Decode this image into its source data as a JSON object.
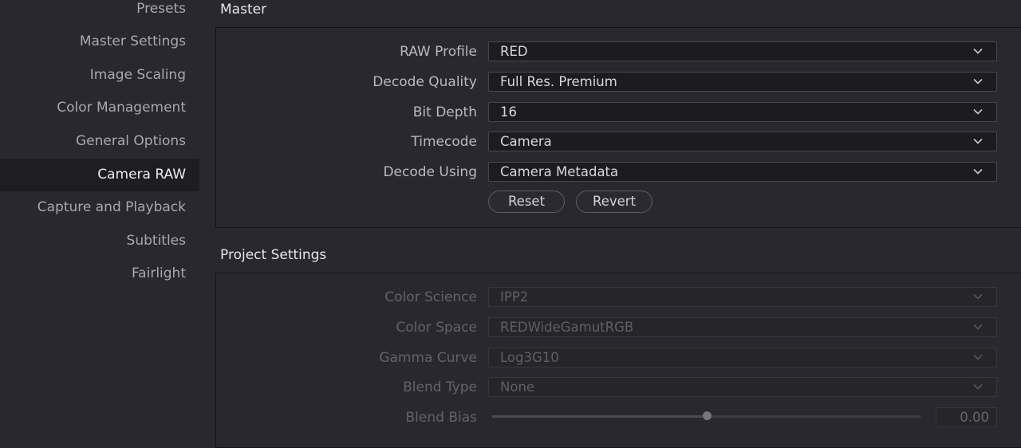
{
  "sidebar": {
    "items": [
      {
        "label": "Presets",
        "active": false
      },
      {
        "label": "Master Settings",
        "active": false
      },
      {
        "label": "Image Scaling",
        "active": false
      },
      {
        "label": "Color Management",
        "active": false
      },
      {
        "label": "General Options",
        "active": false
      },
      {
        "label": "Camera RAW",
        "active": true
      },
      {
        "label": "Capture and Playback",
        "active": false
      },
      {
        "label": "Subtitles",
        "active": false
      },
      {
        "label": "Fairlight",
        "active": false
      }
    ]
  },
  "master": {
    "title": "Master",
    "raw_profile": {
      "label": "RAW Profile",
      "value": "RED"
    },
    "decode_quality": {
      "label": "Decode Quality",
      "value": "Full Res. Premium"
    },
    "bit_depth": {
      "label": "Bit Depth",
      "value": "16"
    },
    "timecode": {
      "label": "Timecode",
      "value": "Camera"
    },
    "decode_using": {
      "label": "Decode Using",
      "value": "Camera Metadata"
    },
    "reset_label": "Reset",
    "revert_label": "Revert"
  },
  "project": {
    "title": "Project Settings",
    "color_science": {
      "label": "Color Science",
      "value": "IPP2"
    },
    "color_space": {
      "label": "Color Space",
      "value": "REDWideGamutRGB"
    },
    "gamma_curve": {
      "label": "Gamma Curve",
      "value": "Log3G10"
    },
    "blend_type": {
      "label": "Blend Type",
      "value": "None"
    },
    "blend_bias": {
      "label": "Blend Bias",
      "value": "0.00",
      "slider_fraction": 0.5
    }
  },
  "icons": {
    "dropdown": "chevron-down-icon"
  },
  "colors": {
    "background": "#28282e",
    "active_item": "#1e1e22",
    "field": "#1c1c20"
  }
}
